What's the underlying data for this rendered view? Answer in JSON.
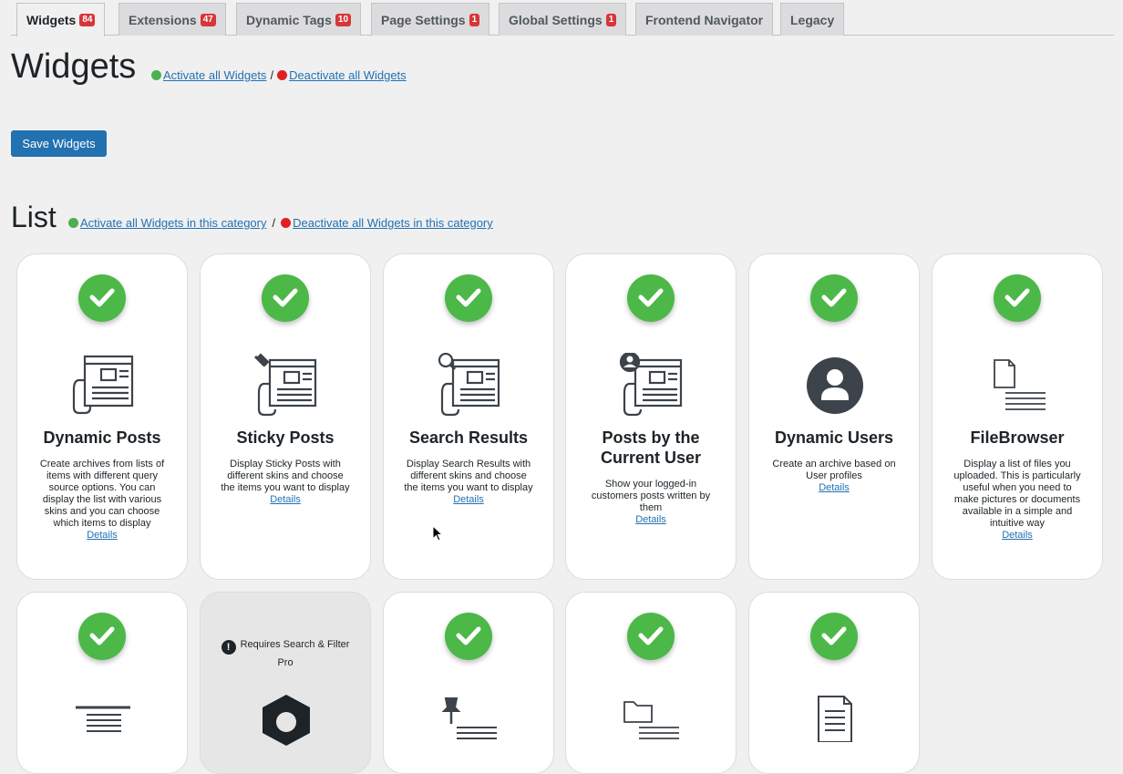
{
  "tabs": [
    {
      "label": "Widgets",
      "count": "84"
    },
    {
      "label": "Extensions",
      "count": "47"
    },
    {
      "label": "Dynamic Tags",
      "count": "10"
    },
    {
      "label": "Page Settings",
      "count": "1"
    },
    {
      "label": "Global Settings",
      "count": "1"
    },
    {
      "label": "Frontend Navigator",
      "count": ""
    },
    {
      "label": "Legacy",
      "count": ""
    }
  ],
  "page": {
    "title": "Widgets",
    "activate_all": "Activate all Widgets",
    "deactivate_all": "Deactivate all Widgets",
    "separator": "/",
    "save_label": "Save Widgets"
  },
  "category": {
    "title": "List",
    "activate_all": "Activate all Widgets in this category",
    "deactivate_all": "Deactivate all Widgets in this category",
    "separator": "/"
  },
  "details_label": "Details",
  "cards": [
    {
      "title": "Dynamic Posts",
      "description": "Create archives from lists of items with different query source options. You can display the list with various skins and you can choose which items to display",
      "icon": "posts-archive-icon",
      "active": true
    },
    {
      "title": "Sticky Posts",
      "description": "Display Sticky Posts with different skins and choose the items you want to display",
      "icon": "sticky-posts-icon",
      "active": true
    },
    {
      "title": "Search Results",
      "description": "Display Search Results with different skins and choose the items you want to display",
      "icon": "search-results-icon",
      "active": true
    },
    {
      "title": "Posts by the Current User",
      "description": "Show your logged-in customers posts written by them",
      "icon": "user-posts-icon",
      "active": true
    },
    {
      "title": "Dynamic Users",
      "description": "Create an archive based on User profiles",
      "icon": "user-profile-icon",
      "active": true
    },
    {
      "title": "FileBrowser",
      "description": "Display a list of files you uploaded. This is particularly useful when you need to make pictures or documents available in a simple and intuitive way",
      "icon": "file-list-icon",
      "active": true
    }
  ],
  "row2_cards": [
    {
      "icon": "text-lines-icon",
      "active": true
    },
    {
      "icon": "hexagon-nut-icon",
      "active": false,
      "requirement": "Requires Search & Filter Pro"
    },
    {
      "icon": "pin-list-icon",
      "active": true
    },
    {
      "icon": "folder-list-icon",
      "active": true
    },
    {
      "icon": "document-icon",
      "active": true
    }
  ],
  "colors": {
    "accent": "#2271b1",
    "active": "#4cb848",
    "badge": "#d63638",
    "inactive_dot": "#e02020"
  }
}
